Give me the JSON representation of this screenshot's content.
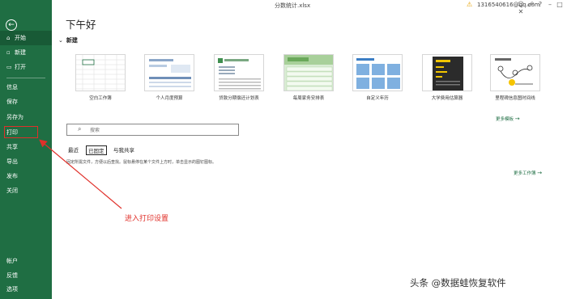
{
  "window": {
    "title": "分数统计.xlsx",
    "account": "1316540616@qq.com",
    "warning_icon": "warning-icon"
  },
  "sidebar": {
    "back_icon": "back-arrow-icon",
    "items": [
      {
        "label": "开始",
        "icon": "home-icon"
      },
      {
        "label": "新建",
        "icon": "new-file-icon"
      },
      {
        "label": "打开",
        "icon": "folder-icon"
      },
      {
        "label": "信息"
      },
      {
        "label": "保存"
      },
      {
        "label": "另存为"
      },
      {
        "label": "打印"
      },
      {
        "label": "共享"
      },
      {
        "label": "导出"
      },
      {
        "label": "发布"
      },
      {
        "label": "关闭"
      }
    ],
    "bottom_items": [
      {
        "label": "帐户"
      },
      {
        "label": "反馈"
      },
      {
        "label": "选项"
      }
    ],
    "accent_color": "#1f6e43"
  },
  "main": {
    "greeting": "下午好",
    "new_section": "新建",
    "templates": [
      {
        "label": "空白工作簿"
      },
      {
        "label": "个人月度预算"
      },
      {
        "label": "贷款分期偿还计划表"
      },
      {
        "label": "每周家务安排表"
      },
      {
        "label": "自定义年历"
      },
      {
        "label": "大学费用估算器"
      },
      {
        "label": "里程碑信息图时间线"
      }
    ],
    "more_templates": "更多模板",
    "search": {
      "placeholder": "搜索"
    },
    "tabs": [
      {
        "label": "最近"
      },
      {
        "label": "已固定"
      },
      {
        "label": "与我共享"
      }
    ],
    "pinned_hint": "固定所需文件，方便以后查找。鼠标悬停在某个文件上方时，单击显示的图钉图标。",
    "more_workbooks": "更多工作簿"
  },
  "annotation": {
    "text": "进入打印设置",
    "color": "#e0302a"
  },
  "watermark": "头条 @数据蛙恢复软件"
}
